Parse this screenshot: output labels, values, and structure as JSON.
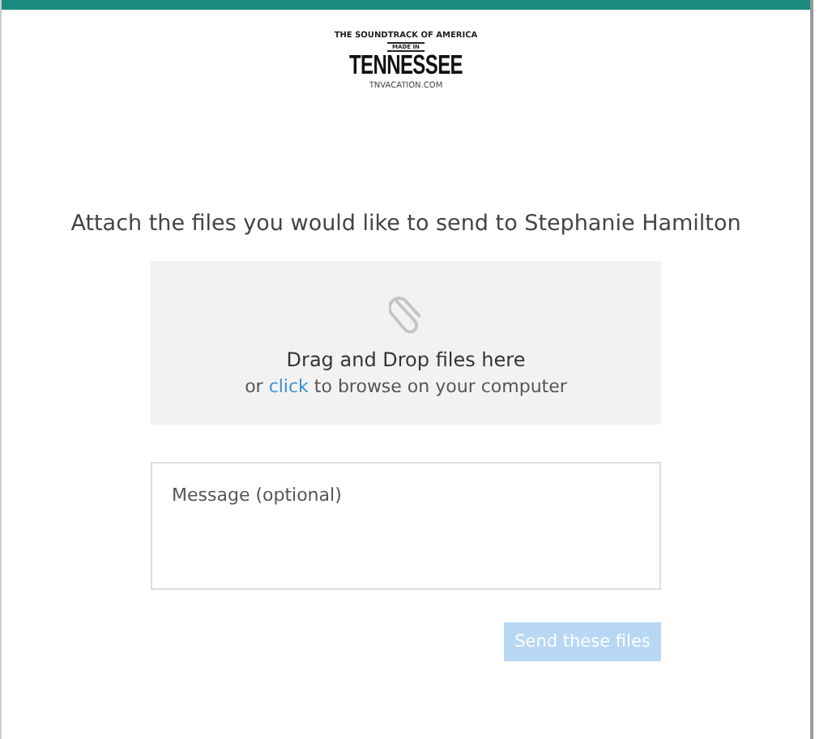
{
  "logo": {
    "arc": "THE SOUNDTRACK OF AMERICA",
    "banner": "MADE IN",
    "name": "TENNESSEE",
    "url": "TNVACATION.COM"
  },
  "heading": "Attach the files you would like to send to Stephanie Hamilton",
  "dropzone": {
    "title": "Drag and Drop files here",
    "prefix": "or",
    "link": "click",
    "suffix": "to browse on your computer"
  },
  "message": {
    "placeholder": "Message (optional)"
  },
  "submit": {
    "label": "Send these files",
    "disabled": true
  }
}
